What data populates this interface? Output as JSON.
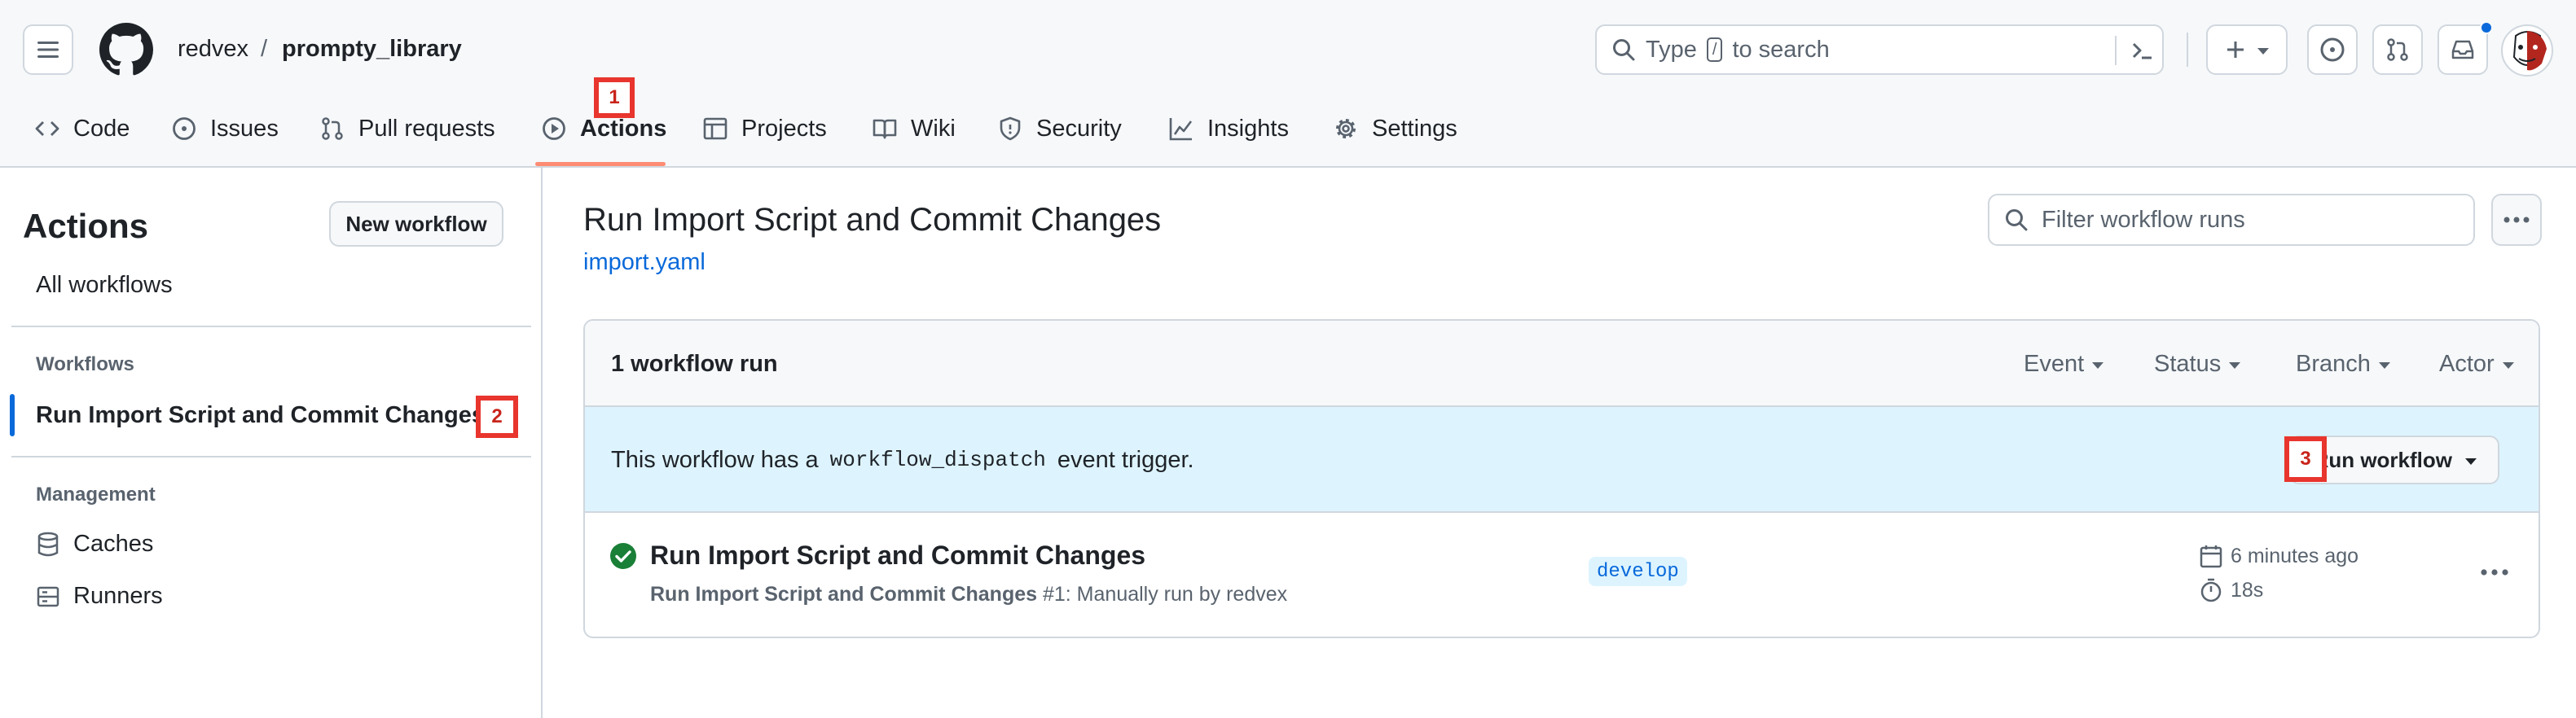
{
  "header": {
    "owner": "redvex",
    "separator": "/",
    "repo": "prompty_library",
    "search": {
      "prefix": "Type",
      "key": "/",
      "suffix": "to search"
    },
    "notification_dot_color": "#0969da"
  },
  "nav": {
    "tabs": [
      {
        "label": "Code",
        "icon": "code-icon"
      },
      {
        "label": "Issues",
        "icon": "issue-icon"
      },
      {
        "label": "Pull requests",
        "icon": "pull-request-icon"
      },
      {
        "label": "Actions",
        "icon": "play-icon",
        "selected": true
      },
      {
        "label": "Projects",
        "icon": "table-icon"
      },
      {
        "label": "Wiki",
        "icon": "book-icon"
      },
      {
        "label": "Security",
        "icon": "shield-icon"
      },
      {
        "label": "Insights",
        "icon": "graph-icon"
      },
      {
        "label": "Settings",
        "icon": "gear-icon"
      }
    ]
  },
  "markers": {
    "m1": "1",
    "m2": "2",
    "m3": "3"
  },
  "sidebar": {
    "title": "Actions",
    "new_workflow": "New workflow",
    "all_workflows": "All workflows",
    "workflows_heading": "Workflows",
    "workflow_item": "Run Import Script and Commit Changes",
    "management_heading": "Management",
    "caches": "Caches",
    "runners": "Runners"
  },
  "main": {
    "title": "Run Import Script and Commit Changes",
    "file_link": "import.yaml",
    "filter_placeholder": "Filter workflow runs",
    "run_count": "1 workflow run",
    "filters": [
      "Event",
      "Status",
      "Branch",
      "Actor"
    ],
    "notice": {
      "prefix": "This workflow has a",
      "code": "workflow_dispatch",
      "suffix": "event trigger."
    },
    "run_workflow_button": "Run workflow",
    "run": {
      "title": "Run Import Script and Commit Changes",
      "subtitle_bold": "Run Import Script and Commit Changes",
      "subtitle_rest": "#1: Manually run by redvex",
      "branch": "develop",
      "time_ago": "6 minutes ago",
      "duration": "18s",
      "status": "success",
      "status_color": "#1a7f37"
    }
  }
}
